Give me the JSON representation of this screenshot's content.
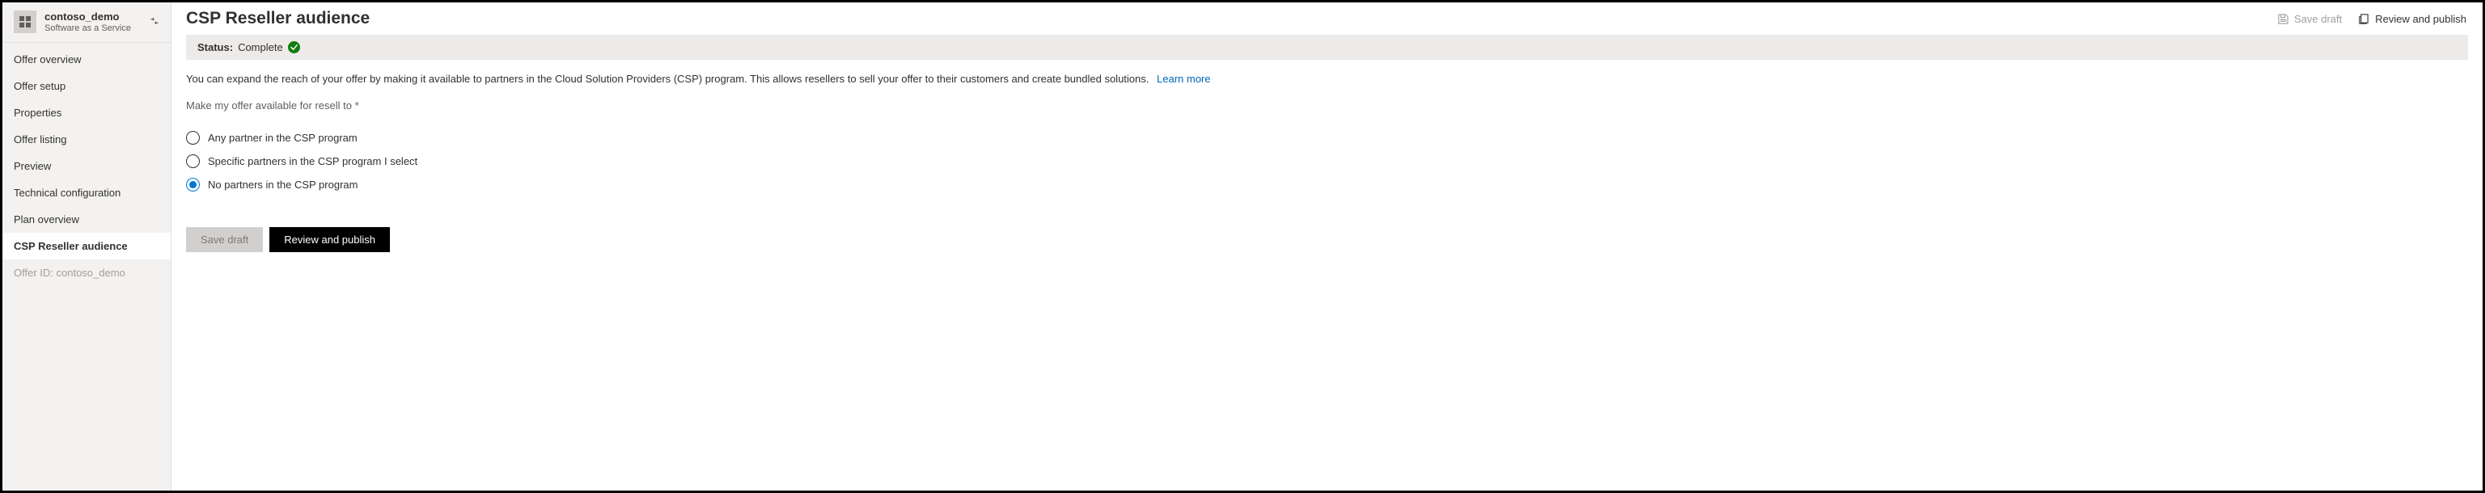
{
  "sidebar": {
    "title": "contoso_demo",
    "subtitle": "Software as a Service",
    "items": [
      {
        "label": "Offer overview"
      },
      {
        "label": "Offer setup"
      },
      {
        "label": "Properties"
      },
      {
        "label": "Offer listing"
      },
      {
        "label": "Preview"
      },
      {
        "label": "Technical configuration"
      },
      {
        "label": "Plan overview"
      },
      {
        "label": "CSP Reseller audience"
      }
    ],
    "selected_index": 7,
    "offer_id_label": "Offer ID: contoso_demo"
  },
  "header": {
    "title": "CSP Reseller audience",
    "save_draft_label": "Save draft",
    "review_publish_label": "Review and publish"
  },
  "status": {
    "label": "Status:",
    "value": "Complete",
    "state": "complete",
    "badge_color": "#107c10"
  },
  "intro": {
    "text": "You can expand the reach of your offer by making it available to partners in the Cloud Solution Providers (CSP) program. This allows resellers to sell your offer to their customers and create bundled solutions.",
    "learn_more_label": "Learn more"
  },
  "form": {
    "label": "Make my offer available for resell to *",
    "options": [
      {
        "label": "Any partner in the CSP program"
      },
      {
        "label": "Specific partners in the CSP program I select"
      },
      {
        "label": "No partners in the CSP program"
      }
    ],
    "selected_index": 2
  },
  "actions": {
    "save_draft_label": "Save draft",
    "review_publish_label": "Review and publish"
  }
}
